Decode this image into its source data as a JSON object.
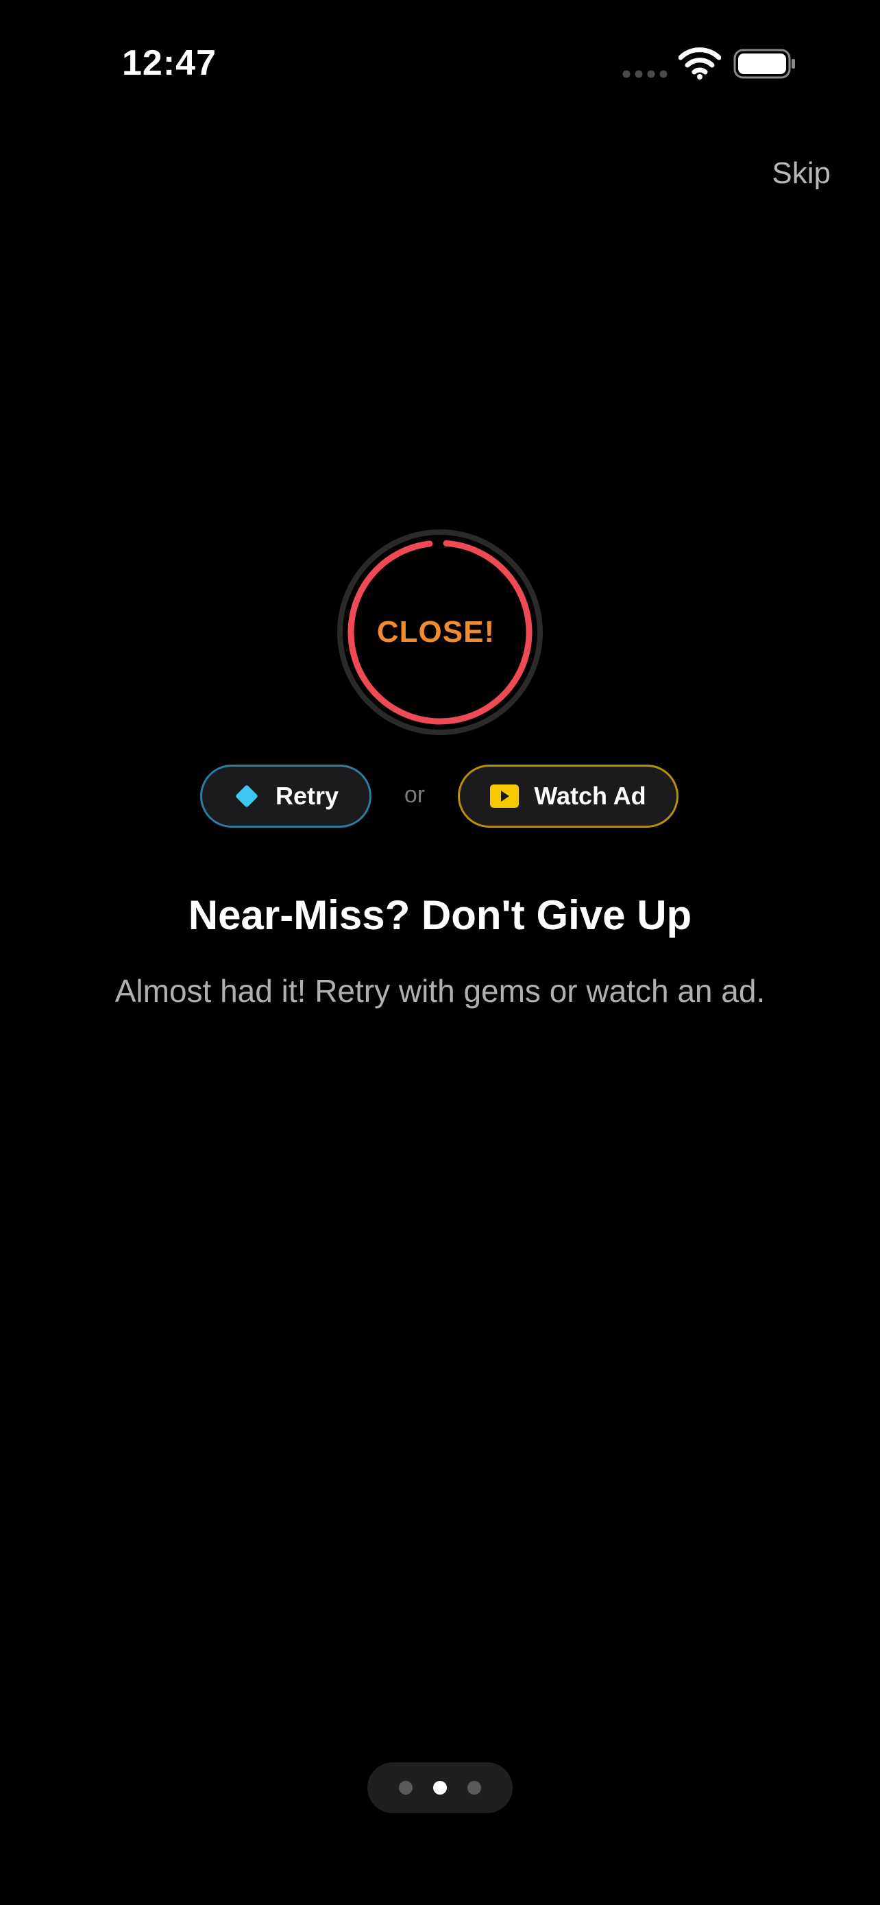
{
  "status_bar": {
    "time": "12:47",
    "icons": [
      "signal-icon",
      "wifi-icon",
      "battery-icon"
    ]
  },
  "header": {
    "skip_label": "Skip"
  },
  "result_ring": {
    "label": "CLOSE!",
    "progress_fraction": 0.97,
    "colors": {
      "track": "#2a2a2a",
      "progress": "#f04a55",
      "label": "#f28a2e"
    }
  },
  "actions": {
    "retry": {
      "label": "Retry",
      "icon": "gem-icon",
      "border_color": "#2c7da0",
      "icon_color": "#3cc8f0"
    },
    "separator": "or",
    "watch_ad": {
      "label": "Watch Ad",
      "icon": "play-icon",
      "border_color": "#b8900f",
      "icon_color": "#f5c800"
    }
  },
  "content": {
    "title": "Near-Miss? Don't Give Up",
    "subtitle": "Almost had it! Retry with gems or watch an ad."
  },
  "pagination": {
    "pages": 3,
    "current_index": 1
  }
}
